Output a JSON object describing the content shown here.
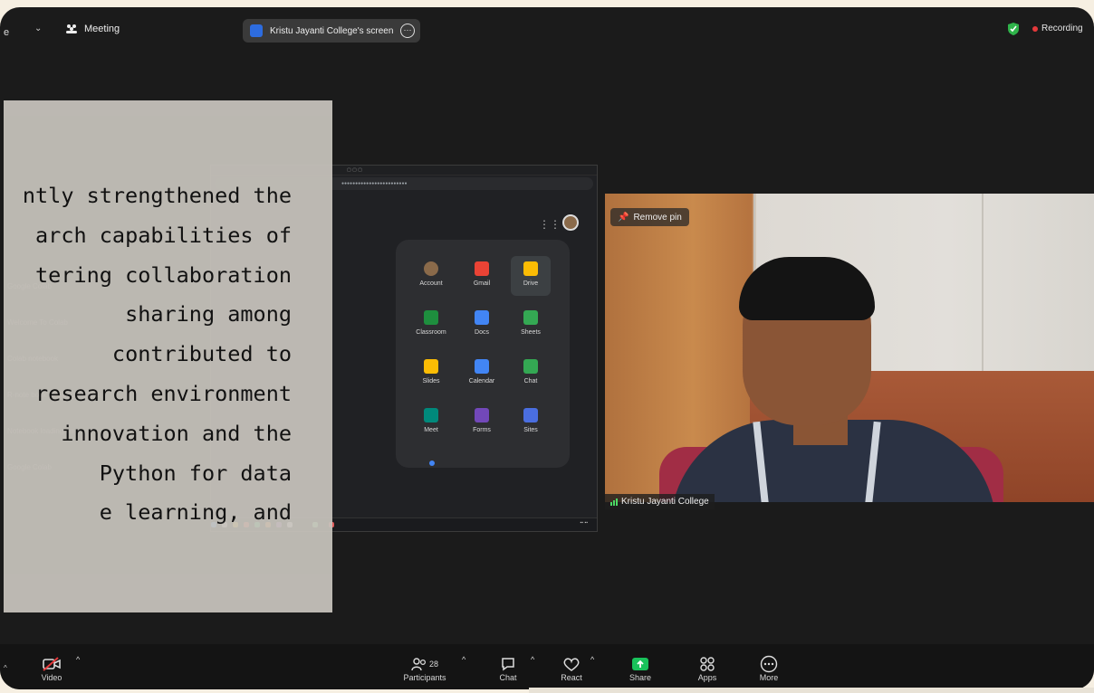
{
  "topbar": {
    "edge_letter": "e",
    "view_caret": "⌄",
    "meeting_label": "Meeting",
    "share_label": "Kristu Jayanti College's screen",
    "share_more": "···",
    "recording_label": "Recording"
  },
  "overlay": {
    "lines": [
      "ntly strengthened the",
      "arch capabilities of",
      "tering collaboration",
      "sharing      among",
      "contributed      to",
      "research environment",
      "innovation and the",
      "Python    for   data",
      "e   learning,    and"
    ]
  },
  "shared_screen": {
    "apps": [
      {
        "label": "Account",
        "color": "#8a6a4a"
      },
      {
        "label": "Gmail",
        "color": "#ea4335"
      },
      {
        "label": "Drive",
        "color": "#fbbc04"
      },
      {
        "label": "Classroom",
        "color": "#1e8e3e"
      },
      {
        "label": "Docs",
        "color": "#4285f4"
      },
      {
        "label": "Sheets",
        "color": "#34a853"
      },
      {
        "label": "Slides",
        "color": "#fbbc04"
      },
      {
        "label": "Calendar",
        "color": "#4285f4"
      },
      {
        "label": "Chat",
        "color": "#34a853"
      },
      {
        "label": "Meet",
        "color": "#00897b"
      },
      {
        "label": "Forms",
        "color": "#7248b9"
      },
      {
        "label": "Sites",
        "color": "#4a6ee0"
      }
    ],
    "ghost_items": [
      "Google Colab",
      "Welcome To Colab",
      "Colab notebook",
      "R-note book of Google Colab",
      "Notebook loading error",
      "Google Colab"
    ]
  },
  "video": {
    "pin_label": "Remove pin",
    "participant_name": "Kristu Jayanti College"
  },
  "toolbar": {
    "video_label": "Video",
    "participants_label": "Participants",
    "participants_count": "28",
    "chat_label": "Chat",
    "react_label": "React",
    "share_label": "Share",
    "apps_label": "Apps",
    "more_label": "More"
  }
}
